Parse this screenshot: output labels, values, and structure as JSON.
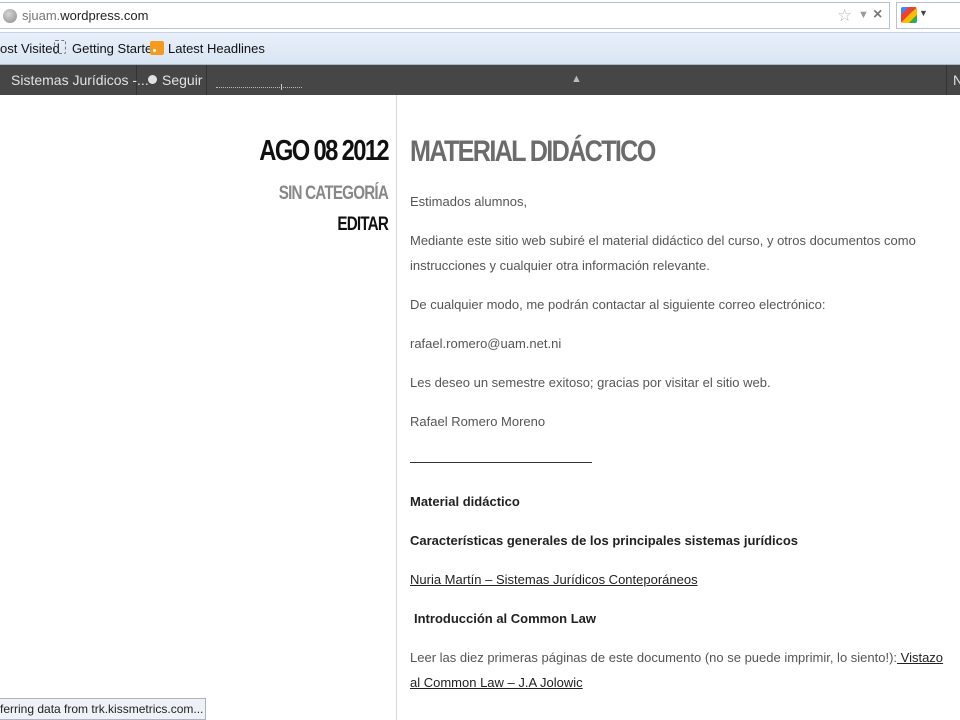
{
  "browser": {
    "url_prefix": "sjuam.",
    "url_domain": "wordpress.com",
    "status_text": "ferring data from trk.kissmetrics.com..."
  },
  "bookmarks": [
    {
      "label": "ost Visited"
    },
    {
      "label": "Getting Started"
    },
    {
      "label": "Latest Headlines"
    }
  ],
  "adminbar": {
    "site_label": "Sistemas Jurídicos -...",
    "follow_label": "Seguir",
    "right_letter": "N"
  },
  "meta": {
    "date": "AGO 08 2012",
    "category": "SIN CATEGORÍA",
    "edit": "EDITAR"
  },
  "post": {
    "title": "MATERIAL DIDÁCTICO",
    "greeting": "Estimados alumnos,",
    "p1": "Mediante este sitio web subiré el material didáctico del curso, y otros documentos como instrucciones y cualquier otra información relevante.",
    "p2": "De cualquier modo, me podrán contactar al siguiente correo electrónico:",
    "email": "rafael.romero@uam.net.ni",
    "p3": "Les deseo un semestre exitoso; gracias por visitar el sitio web.",
    "signature": "Rafael Romero Moreno",
    "section_title": "Material didáctico",
    "sub1": "Características generales de los principales sistemas jurídicos",
    "link1": "Nuria Martín – Sistemas Jurídicos Conteporáneos",
    "sub2": "Introducción al Common Law",
    "p4_text": "Leer las diez primeras páginas de este documento (no se puede imprimir, lo siento!):",
    "link2": " Vistazo al Common Law – J.A Jolowic"
  }
}
